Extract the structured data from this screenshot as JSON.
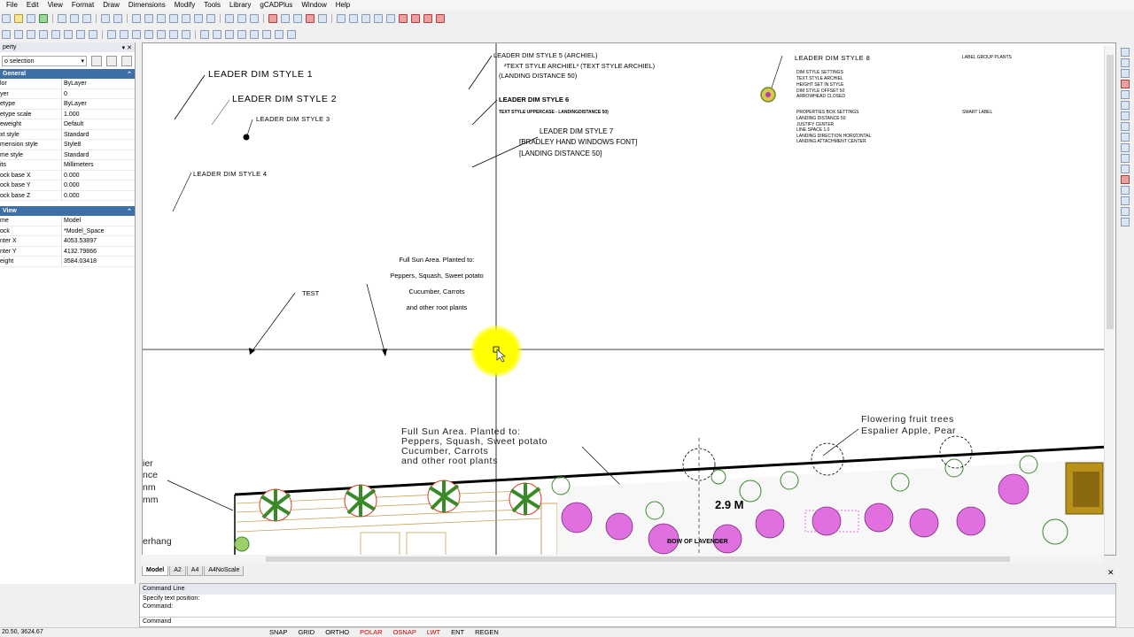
{
  "menu": [
    "File",
    "Edit",
    "View",
    "Format",
    "Draw",
    "Dimensions",
    "Modify",
    "Tools",
    "Library",
    "gCADPlus",
    "Window",
    "Help"
  ],
  "panel": {
    "title": "perty",
    "selection": "o selection",
    "general_title": "General",
    "general": [
      {
        "k": "lor",
        "v": "ByLayer"
      },
      {
        "k": "yer",
        "v": "0"
      },
      {
        "k": "etype",
        "v": "ByLayer"
      },
      {
        "k": "etype scale",
        "v": "1.000"
      },
      {
        "k": "eweight",
        "v": "Default"
      },
      {
        "k": "xt style",
        "v": "Standard"
      },
      {
        "k": "mension style",
        "v": "Style8"
      },
      {
        "k": "me style",
        "v": "Standard"
      },
      {
        "k": "its",
        "v": "Millimeters"
      },
      {
        "k": "ock base X",
        "v": "0.000"
      },
      {
        "k": "ock base Y",
        "v": "0.000"
      },
      {
        "k": "ock base Z",
        "v": "0.000"
      }
    ],
    "view_title": "View",
    "view": [
      {
        "k": "me",
        "v": "Model"
      },
      {
        "k": "ock",
        "v": "*Model_Space"
      },
      {
        "k": "nter X",
        "v": "4053.53897"
      },
      {
        "k": "nter Y",
        "v": "4132.79866"
      },
      {
        "k": "eight",
        "v": "3584.03418"
      }
    ]
  },
  "drawing": {
    "leader1": "LEADER DIM STYLE 1",
    "leader2": "LEADER DIM STYLE 2",
    "leader3": "LEADER DIM STYLE 3",
    "leader4": "LEADER DIM STYLE 4",
    "leader5": [
      "LEADER DIM STYLE 5 (ARCHIEL)",
      "²TEXT STYLE ARCHIEL³ (TEXT STYLE ARCHIEL)",
      "(LANDING DISTANCE 50)"
    ],
    "leader6": [
      "LEADER DIM STYLE 6",
      "TEXT STYLE UPPERCASE - LANDINGDISTANCE 50)"
    ],
    "leader7": [
      "LEADER DIM STYLE 7",
      "[BRADLEY HAND WINDOWS FONT]",
      "[LANDING DISTANCE 50]"
    ],
    "leader8": "LEADER DIM STYLE 8",
    "dim_settings": [
      "DIM STYLE SETTINGS",
      "TEXT STYLE ARCHIEL",
      "HEIGHT SET IN STYLE",
      "DIM STYLE OFFSET 50",
      "ARROWHEAD CLOSED"
    ],
    "prop_settings": [
      "PROPERTIES BOX SETTINGS",
      "LANDING DISTANCE 50",
      "JUSTIFY CENTER",
      "LINE SPACE 1.0",
      "LANDING DIRECTION HORIZONTAL",
      "LANDING ATTACHMENT CENTER"
    ],
    "label_group": "LABEL GROUP PLANTS",
    "smart_label": "SMART LABEL",
    "test": "TEST",
    "sun_small": [
      "Full Sun Area. Planted to:",
      "Peppers, Squash, Sweet potato",
      "Cucumber, Carrots",
      "and other root plants"
    ],
    "sun_large": [
      "Full Sun Area. Planted to:",
      "Peppers, Squash, Sweet potato",
      "Cucumber, Carrots",
      "and other root plants"
    ],
    "fruit": [
      "Flowering fruit trees",
      "Espalier Apple, Pear"
    ],
    "dim_value": "2.9 M",
    "bow": "BOW OF LAVENDER",
    "left_frag": [
      "ier",
      "nce",
      "nm",
      "mm",
      "erhang"
    ]
  },
  "tabs": [
    "Model",
    "A2",
    "A4",
    "A4NoScale"
  ],
  "command": {
    "title": "Command Line",
    "lines": [
      "Specify text position:",
      "Command:"
    ],
    "input_label": "Command"
  },
  "status": {
    "coord": "20.50, 3624.67",
    "buttons": [
      {
        "label": "SNAP",
        "on": false
      },
      {
        "label": "GRID",
        "on": false
      },
      {
        "label": "ORTHO",
        "on": false
      },
      {
        "label": "POLAR",
        "on": true
      },
      {
        "label": "OSNAP",
        "on": true
      },
      {
        "label": "LWT",
        "on": true
      },
      {
        "label": "ENT",
        "on": false
      },
      {
        "label": "REGEN",
        "on": false
      }
    ]
  },
  "colors": {
    "accent": "#3f6fa8",
    "highlight": "#ffff00",
    "plant_pink": "#e070e0",
    "status_on": "#cc0000"
  }
}
